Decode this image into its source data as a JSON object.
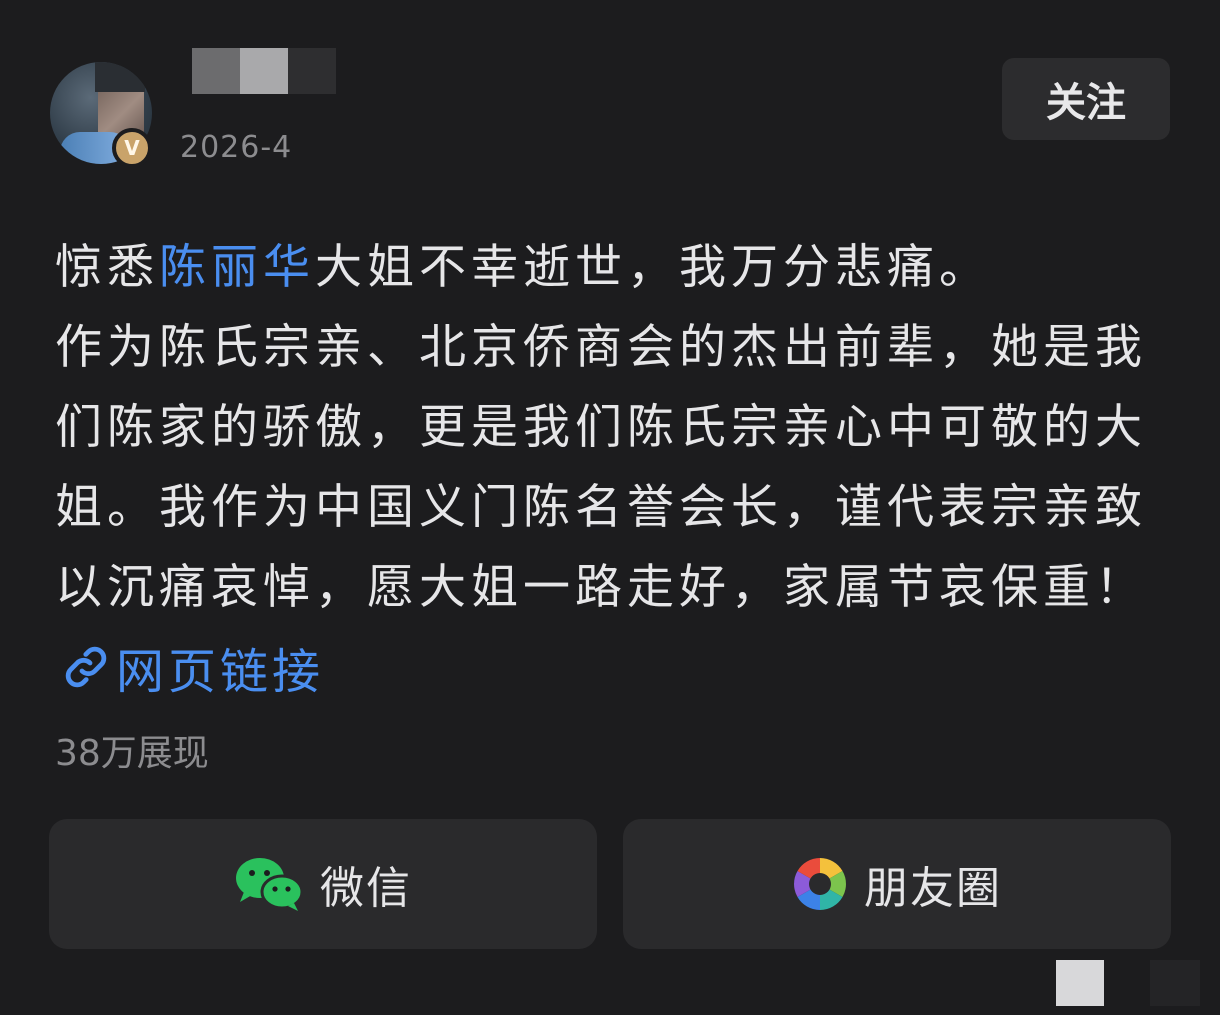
{
  "header": {
    "date": "2026-4",
    "follow_label": "关注",
    "verified_badge_glyph": "V"
  },
  "post": {
    "line1_prefix": "惊悉",
    "mention": "陈丽华",
    "line1_suffix": "大姐不幸逝世，我万分悲痛。",
    "paragraph2": "作为陈氏宗亲、北京侨商会的杰出前辈，她是我们陈家的骄傲，更是我们陈氏宗亲心中可敬的大姐。我作为中国义门陈名誉会长，谨代表宗亲致以沉痛哀悼，愿大姐一路走好，家属节哀保重！",
    "link_label": "网页链接",
    "link_icon": "link-icon",
    "impressions": "38万展现"
  },
  "share": {
    "wechat_label": "微信",
    "wechat_icon": "wechat-icon",
    "moments_label": "朋友圈",
    "moments_icon": "moments-icon"
  },
  "colors": {
    "background": "#1c1c1e",
    "accent_link": "#4a8ef0",
    "text_primary": "#e6e6e8",
    "text_secondary": "#8c8c8f",
    "button_bg": "#2a2a2c",
    "verified": "#c9a36a",
    "wechat_green": "#2ac15d"
  }
}
